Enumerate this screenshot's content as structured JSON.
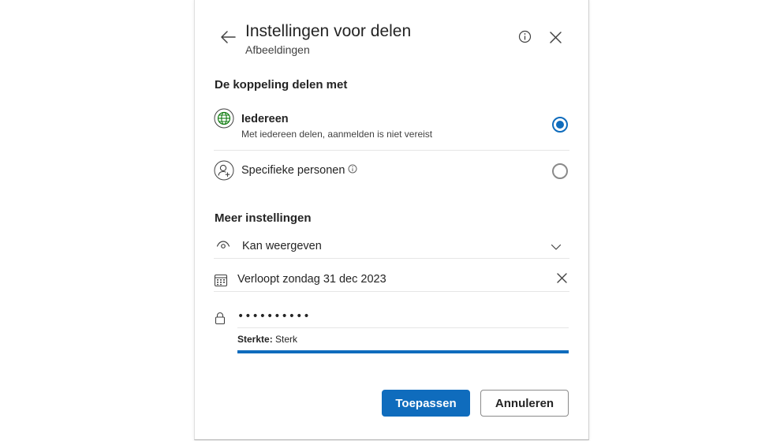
{
  "header": {
    "title": "Instellingen voor delen",
    "subtitle": "Afbeeldingen"
  },
  "share_with": {
    "heading": "De koppeling delen met",
    "options": [
      {
        "label": "Iedereen",
        "description": "Met iedereen delen, aanmelden is niet vereist",
        "icon": "globe-icon",
        "selected": true
      },
      {
        "label": "Specifieke personen",
        "icon": "person-add-icon",
        "selected": false
      }
    ]
  },
  "more_settings": {
    "heading": "Meer instellingen",
    "permission": {
      "value": "Kan weergeven",
      "icon": "eye-icon"
    },
    "expiry": {
      "value": "Verloopt zondag 31 dec 2023",
      "icon": "calendar-icon"
    },
    "password": {
      "value": "••••••••••",
      "strength_label": "Sterkte:",
      "strength_value": "Sterk",
      "strength_fraction": 1.0
    }
  },
  "buttons": {
    "apply": "Toepassen",
    "cancel": "Annuleren"
  },
  "colors": {
    "accent": "#0f6cbd",
    "globe_green": "#107c10"
  }
}
